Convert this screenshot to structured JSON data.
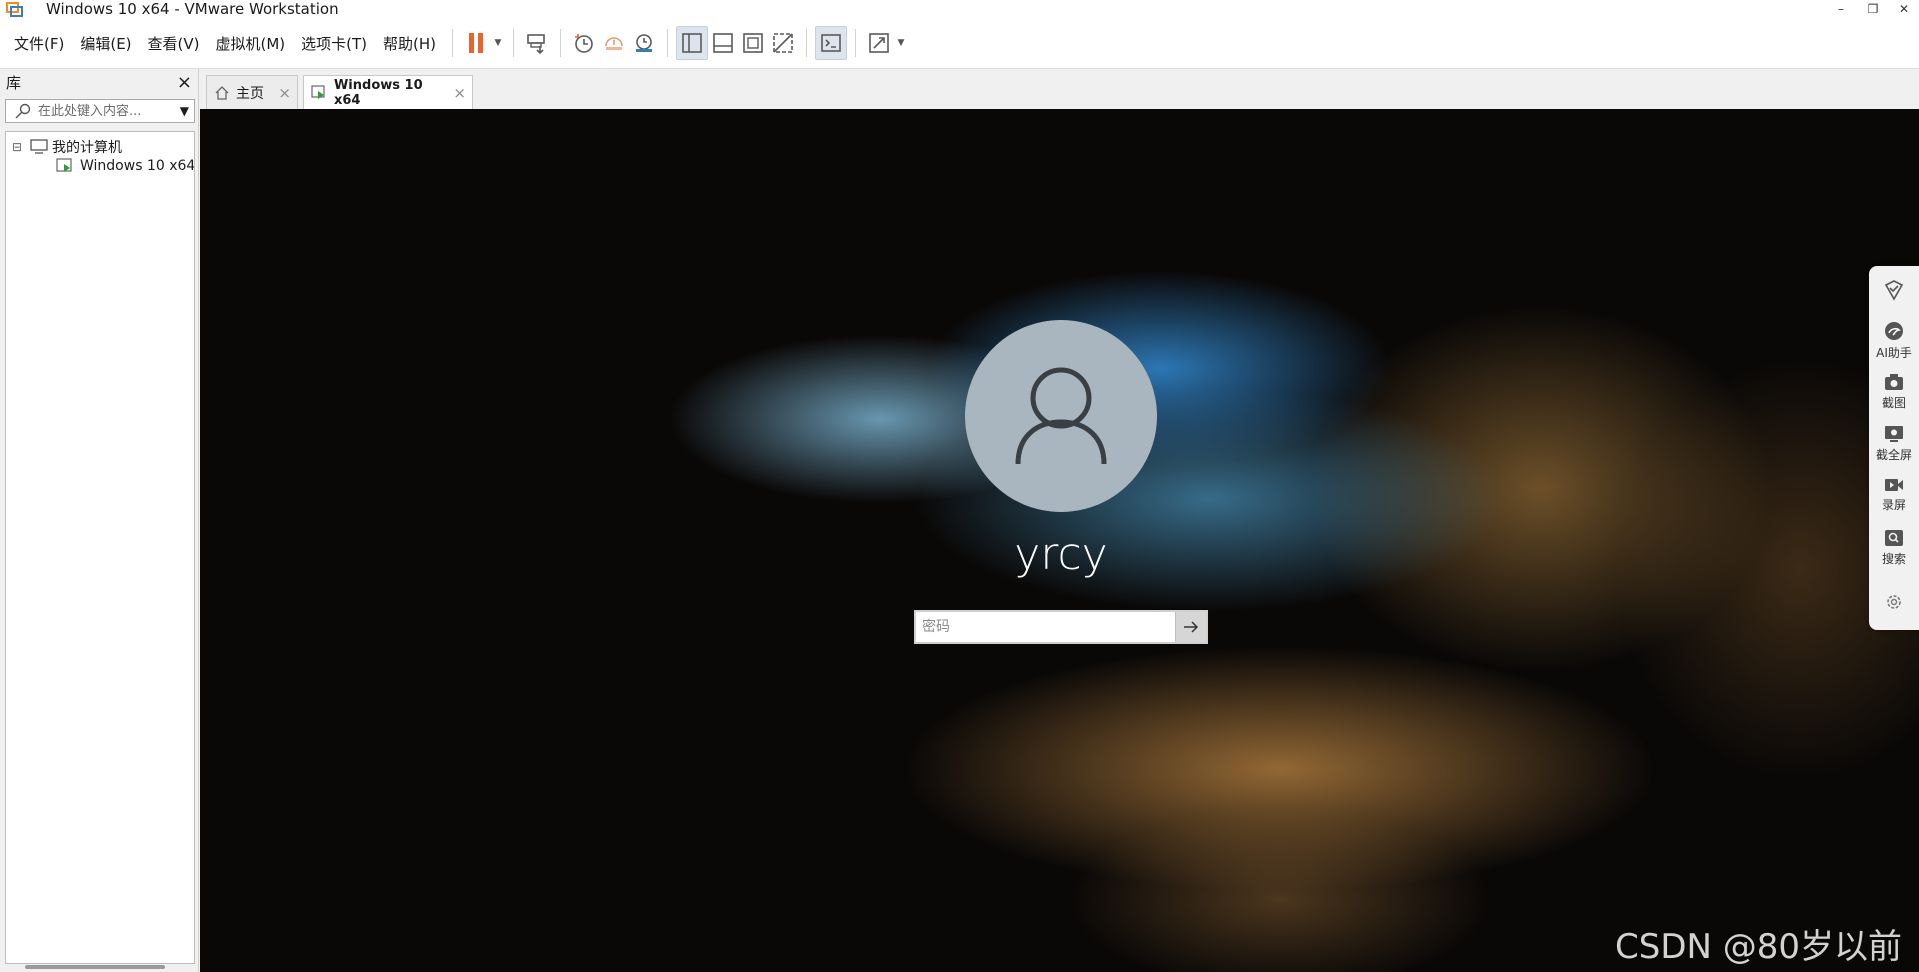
{
  "window": {
    "title": "Windows 10 x64 - VMware Workstation",
    "minimize": "–",
    "restore": "❐",
    "close": "✕"
  },
  "menu": [
    "文件(F)",
    "编辑(E)",
    "查看(V)",
    "虚拟机(M)",
    "选项卡(T)",
    "帮助(H)"
  ],
  "library": {
    "title": "库",
    "close": "×",
    "search_placeholder": "在此处键入内容...",
    "tree": {
      "root_toggle": "⊟",
      "root_label": "我的计算机",
      "vm_label": "Windows 10 x64"
    }
  },
  "tabs": [
    {
      "label": "主页",
      "close": "×"
    },
    {
      "label": "Windows 10 x64",
      "close": "×"
    }
  ],
  "vm": {
    "username": "yrcy",
    "password_placeholder": "密码",
    "watermark": "CSDN @80岁以前"
  },
  "side_tool": {
    "items": [
      {
        "label": "AI助手"
      },
      {
        "label": "截图"
      },
      {
        "label": "截全屏"
      },
      {
        "label": "录屏"
      },
      {
        "label": "搜索"
      }
    ]
  },
  "colors": {
    "pause_orange": "#e8642c",
    "toolbar_icon": "#5a5a5a",
    "snapshot_orange": "#e39a6f",
    "snapshot_blue": "#2f7fb8"
  }
}
